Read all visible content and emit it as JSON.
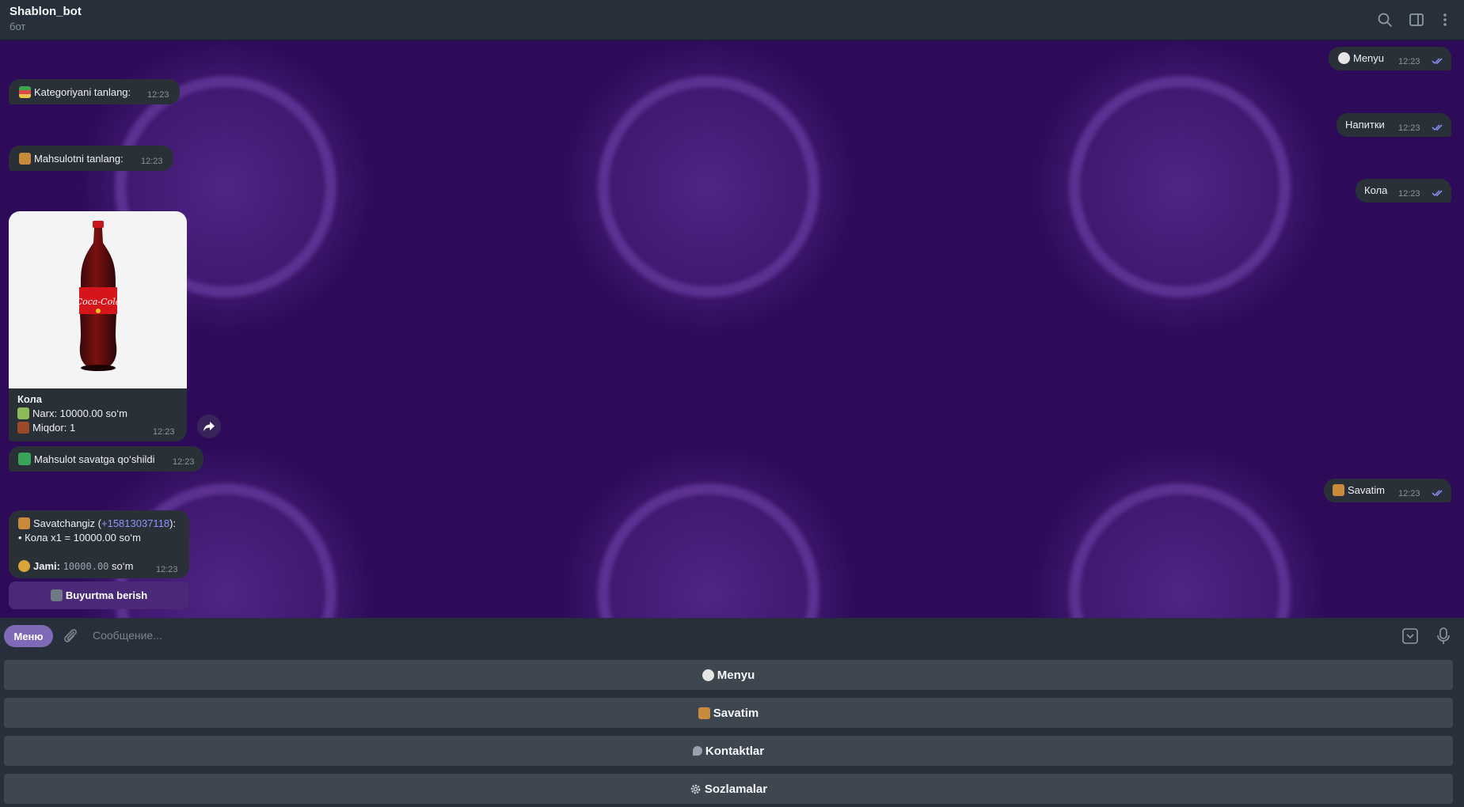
{
  "header": {
    "title": "Shablon_bot",
    "subtitle": "бот"
  },
  "messages": {
    "out_menyu": {
      "text": "Menyu",
      "time": "12:23"
    },
    "in_kategoriya": {
      "text": "Kategoriyani tanlang:",
      "time": "12:23"
    },
    "out_napitki": {
      "text": "Напитки",
      "time": "12:23"
    },
    "in_mahsulot": {
      "text": "Mahsulotni tanlang:",
      "time": "12:23"
    },
    "out_kola": {
      "text": "Кола",
      "time": "12:23"
    },
    "product": {
      "name": "Кола",
      "price_line": "Narx: 10000.00 so‘m",
      "qty_line": "Miqdor: 1",
      "time": "12:23",
      "image_logo": "Coca-Cola"
    },
    "in_added": {
      "text": "Mahsulot savatga qo‘shildi",
      "time": "12:23"
    },
    "out_savatim": {
      "text": "Savatim",
      "time": "12:23"
    },
    "cart": {
      "title_prefix": "Savatchangiz (",
      "phone": "+15813037118",
      "title_suffix": "):",
      "item_line": "• Кола x1 = 10000.00 so‘m",
      "total_label": "Jami:",
      "total_value": "10000.00",
      "total_unit": "so‘m",
      "time": "12:23"
    },
    "inline_button": "Buyurtma berish"
  },
  "input": {
    "menu_button": "Меню",
    "placeholder": "Сообщение..."
  },
  "keyboard": {
    "buttons": [
      "Menyu",
      "Savatim",
      "Kontaktlar",
      "Sozlamalar"
    ]
  },
  "icons": [
    "search-icon",
    "sidebar-toggle-icon",
    "more-vertical-icon",
    "share-icon",
    "paperclip-icon",
    "keyboard-toggle-icon",
    "microphone-icon",
    "double-check-icon"
  ],
  "colors": {
    "header_bg": "#27303a",
    "chat_bg": "#2d0b58",
    "bubble_bg": "#2a3038",
    "accent": "#7e6ab6",
    "inline_button_bg": "#4a2a78",
    "keyboard_button_bg": "#3e4650",
    "link": "#8d94ff"
  }
}
